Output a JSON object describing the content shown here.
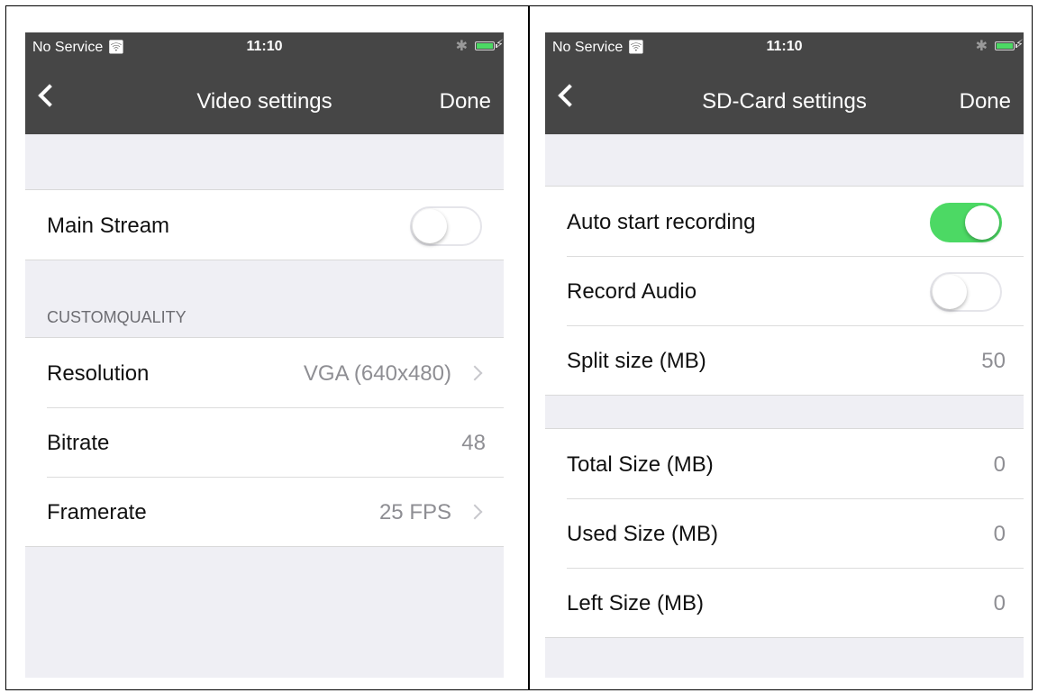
{
  "left_screen": {
    "status": {
      "carrier": "No Service",
      "time": "11:10"
    },
    "nav": {
      "title": "Video settings",
      "done_label": "Done"
    },
    "main_stream": {
      "label": "Main Stream",
      "enabled": false
    },
    "section_header": "CUSTOMQUALITY",
    "rows": {
      "resolution": {
        "label": "Resolution",
        "value": "VGA (640x480)"
      },
      "bitrate": {
        "label": "Bitrate",
        "value": "48"
      },
      "framerate": {
        "label": "Framerate",
        "value": "25 FPS"
      }
    }
  },
  "right_screen": {
    "status": {
      "carrier": "No Service",
      "time": "11:10"
    },
    "nav": {
      "title": "SD-Card settings",
      "done_label": "Done"
    },
    "recording": {
      "auto_start": {
        "label": "Auto start recording",
        "enabled": true
      },
      "record_audio": {
        "label": "Record Audio",
        "enabled": false
      },
      "split_size": {
        "label": "Split size (MB)",
        "value": "50"
      }
    },
    "storage": {
      "total": {
        "label": "Total Size (MB)",
        "value": "0"
      },
      "used": {
        "label": "Used Size (MB)",
        "value": "0"
      },
      "left": {
        "label": "Left Size (MB)",
        "value": "0"
      }
    }
  },
  "colors": {
    "nav_bar": "#464646",
    "background": "#efeff4",
    "toggle_on": "#4cd964",
    "secondary_text": "#8e8e93"
  },
  "icons": [
    "wifi-icon",
    "bluetooth-icon",
    "battery-icon",
    "charging-icon",
    "back-chevron-icon",
    "chevron-right-icon"
  ]
}
